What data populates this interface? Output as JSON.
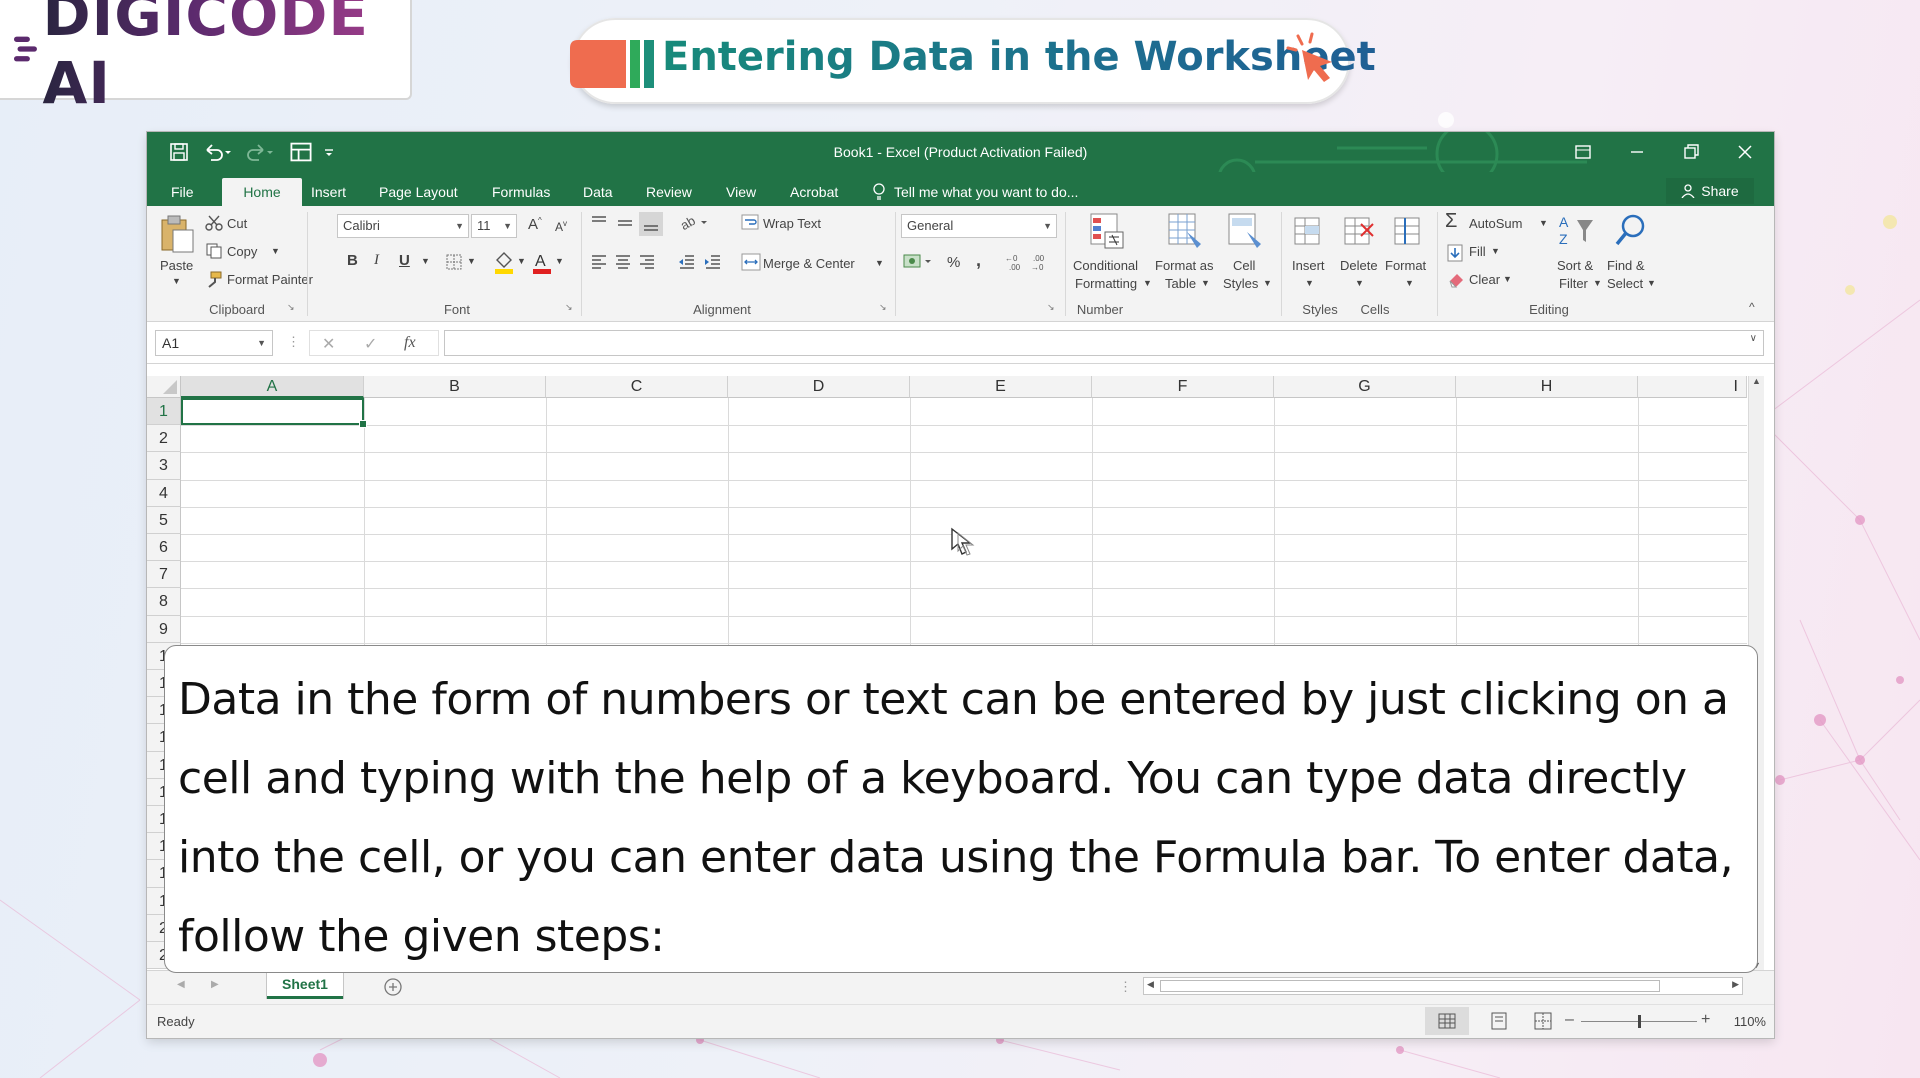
{
  "branding": {
    "logo_text": "DIGICODE AI",
    "slide_title": "Entering Data in the Worksheet"
  },
  "excel": {
    "window_title": "Book1 - Excel (Product Activation Failed)",
    "tabs": [
      "File",
      "Home",
      "Insert",
      "Page Layout",
      "Formulas",
      "Data",
      "Review",
      "View",
      "Acrobat"
    ],
    "active_tab": "Home",
    "tell_me": "Tell me what you want to do...",
    "share": "Share",
    "clipboard": {
      "paste": "Paste",
      "cut": "Cut",
      "copy": "Copy",
      "format_painter": "Format Painter",
      "group": "Clipboard"
    },
    "font": {
      "name": "Calibri",
      "size": "11",
      "bold": "B",
      "italic": "I",
      "underline": "U",
      "group": "Font"
    },
    "alignment": {
      "wrap_text": "Wrap Text",
      "merge_center": "Merge & Center",
      "group": "Alignment"
    },
    "number": {
      "format": "General",
      "percent": "%",
      "comma": ",",
      "group": "Number"
    },
    "styles": {
      "conditional_1": "Conditional",
      "conditional_2": "Formatting",
      "format_table_1": "Format as",
      "format_table_2": "Table",
      "cell_styles_1": "Cell",
      "cell_styles_2": "Styles",
      "group": "Styles"
    },
    "cells": {
      "insert": "Insert",
      "delete": "Delete",
      "format": "Format",
      "group": "Cells"
    },
    "editing": {
      "autosum": "AutoSum",
      "fill": "Fill",
      "clear": "Clear",
      "sort_1": "Sort &",
      "sort_2": "Filter",
      "find_1": "Find &",
      "find_2": "Select",
      "group": "Editing"
    },
    "name_box": "A1",
    "fx": "fx",
    "columns": [
      "A",
      "B",
      "C",
      "D",
      "E",
      "F",
      "G",
      "H",
      "I"
    ],
    "rows": [
      "1",
      "2",
      "3",
      "4",
      "5",
      "6",
      "7",
      "8",
      "9",
      "1",
      "1",
      "1",
      "1",
      "1",
      "1",
      "1",
      "1",
      "1",
      "1",
      "2",
      "2"
    ],
    "sheet_tab": "Sheet1",
    "status": "Ready",
    "zoom": "110%"
  },
  "callout_text": "Data in the form of numbers or text can be entered by just clicking on a cell and typing with the help of a keyboard. You can type data directly into the cell, or you can enter data using the Formula bar. To enter data, follow the given steps:",
  "colors": {
    "excel_green": "#217346",
    "title_teal": "#178a7a",
    "logo_purple": "#5b2a6d"
  }
}
